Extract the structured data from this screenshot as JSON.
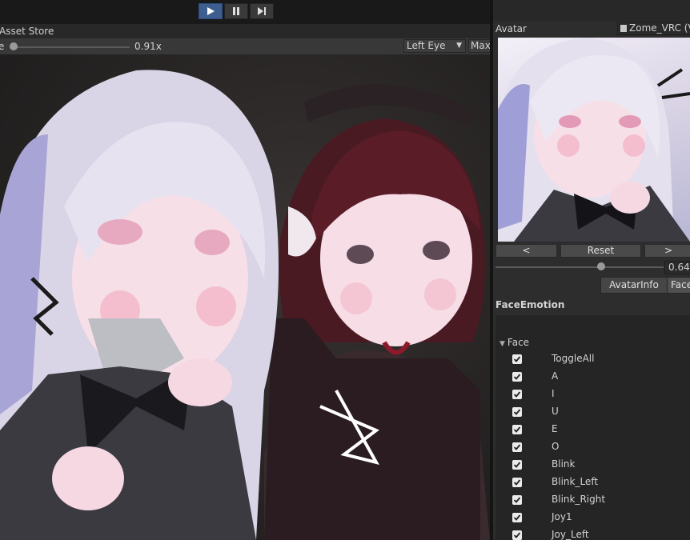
{
  "toolbar": {
    "play_icon": "play-icon",
    "pause_icon": "pause-icon",
    "step_icon": "step-icon",
    "play_active_color": "#3d5e8f"
  },
  "scene": {
    "tab_label": "Asset Store",
    "zoom_label": "e",
    "zoom_value": "0.91x",
    "eye_select": "Left Eye",
    "maximize_label": "Maxi"
  },
  "panel": {
    "avatar_label": "Avatar",
    "avatar_value": "Zome_VRC (V",
    "prev_label": "<",
    "reset_label": "Reset",
    "next_label": ">",
    "blend_value": "0.64",
    "tabs": [
      "AvatarInfo",
      "Face"
    ],
    "section_title": "FaceEmotion",
    "foldout_label": "Face",
    "rows": [
      "ToggleAll",
      "A",
      "I",
      "U",
      "E",
      "O",
      "Blink",
      "Blink_Left",
      "Blink_Right",
      "Joy1",
      "Joy_Left"
    ]
  }
}
